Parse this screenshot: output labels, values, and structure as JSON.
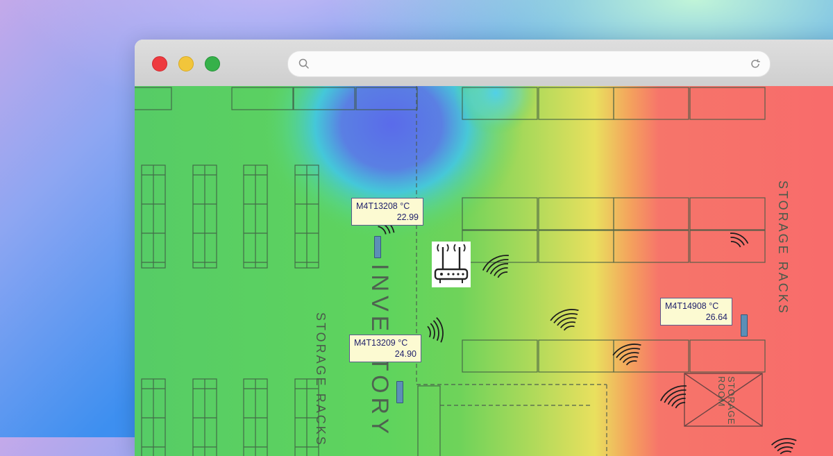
{
  "browser": {
    "url": "",
    "window_controls": [
      "close",
      "minimize",
      "maximize"
    ]
  },
  "floor_plan": {
    "labels": {
      "storage_racks_left": "STORAGE  RACKS",
      "inventory": "INVENTORY",
      "storage_racks_right": "STORAGE  RACKS",
      "storage_room": "STORAGE ROOM"
    }
  },
  "sensors": [
    {
      "id": "M4T13208 °C",
      "value": "22.99"
    },
    {
      "id": "M4T13209 °C",
      "value": "24.90"
    },
    {
      "id": "M4T14908 °C",
      "value": "26.64"
    }
  ],
  "icons": {
    "router": "router-icon",
    "signal": "wifi-signal-icon",
    "search": "search-icon",
    "reload": "reload-icon"
  },
  "colors": {
    "heat_cool": "#5a6bea",
    "heat_neutral": "#5fd45d",
    "heat_warm": "#e9e05e",
    "heat_hot": "#f86b6b",
    "tag_bg": "#fcfad2",
    "sensor": "#5c8fb7"
  }
}
